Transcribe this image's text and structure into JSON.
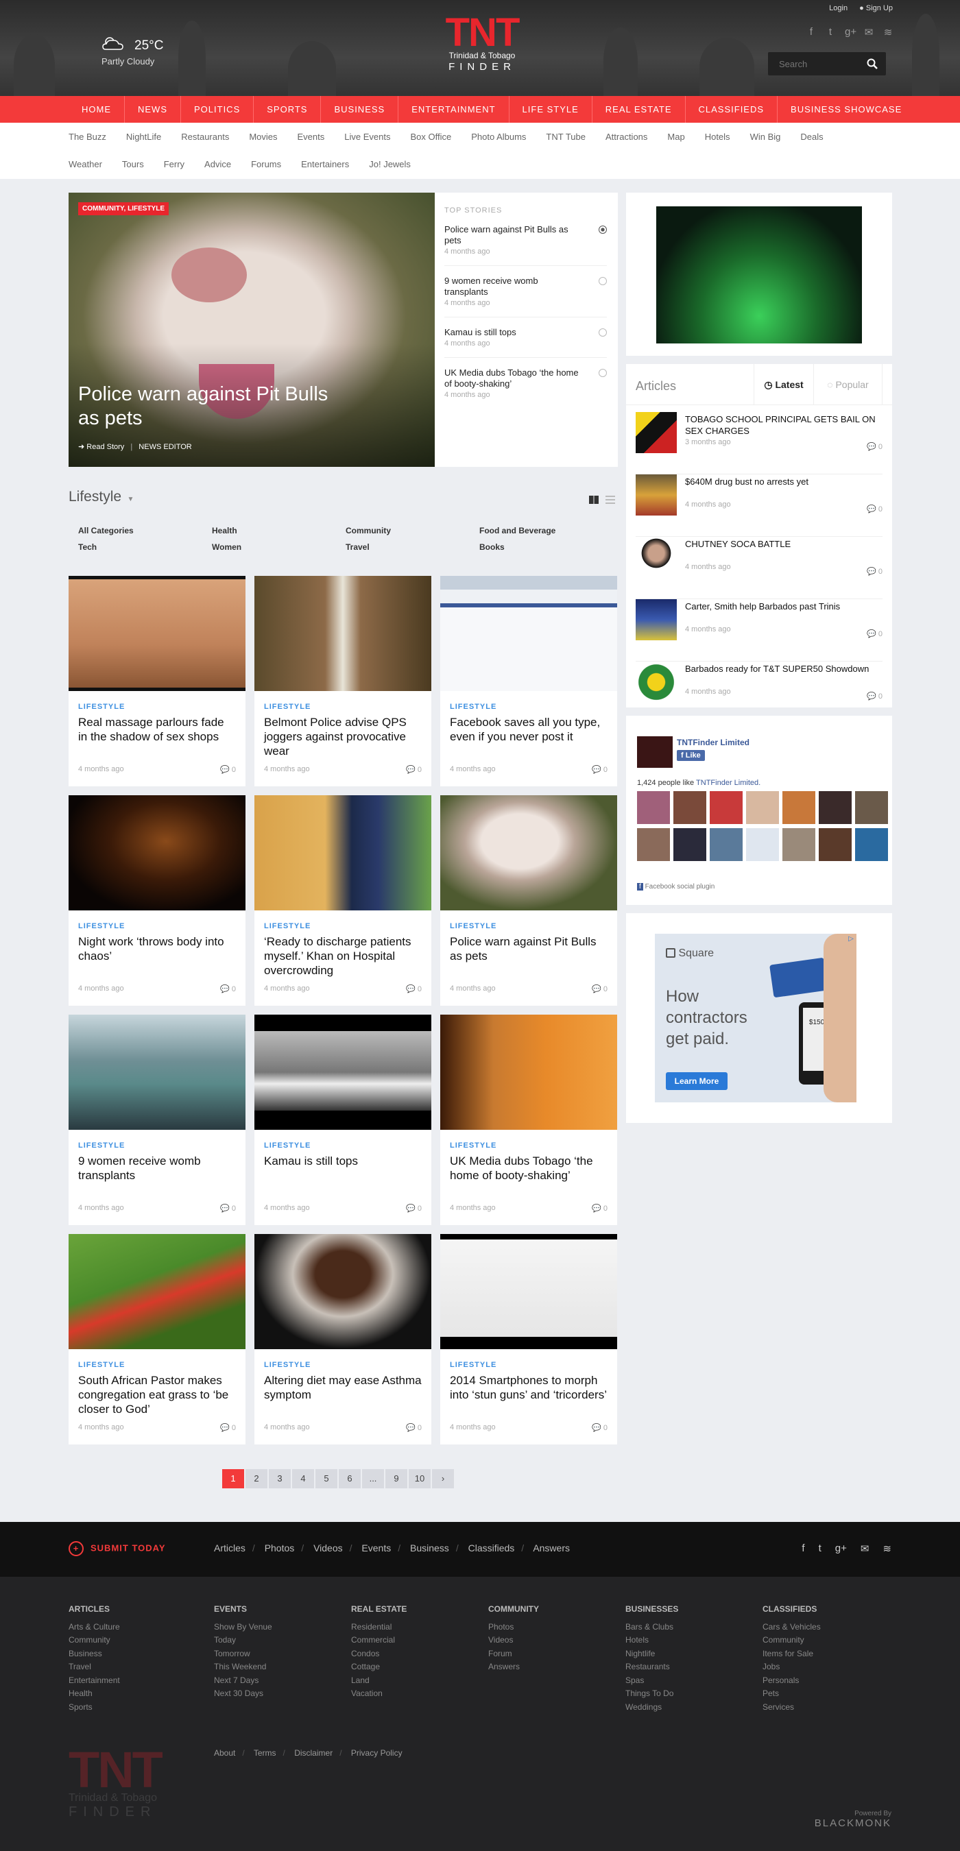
{
  "weather": {
    "temp": "25°C",
    "desc": "Partly Cloudy"
  },
  "logo": {
    "big": "TNT",
    "sub": "Trinidad & Tobago",
    "finder": "FINDER"
  },
  "top_links": {
    "login": "Login",
    "signup": "Sign Up"
  },
  "search": {
    "placeholder": "Search"
  },
  "main_nav": [
    "HOME",
    "NEWS",
    "POLITICS",
    "SPORTS",
    "BUSINESS",
    "ENTERTAINMENT",
    "LIFE STYLE",
    "REAL ESTATE",
    "CLASSIFIEDS",
    "BUSINESS SHOWCASE"
  ],
  "sub_nav_row1": [
    "The Buzz",
    "NightLife",
    "Restaurants",
    "Movies",
    "Events",
    "Live Events",
    "Box Office",
    "Photo Albums",
    "TNT Tube",
    "Attractions",
    "Map",
    "Hotels",
    "Win Big",
    "Deals"
  ],
  "sub_nav_row2": [
    "Weather",
    "Tours",
    "Ferry",
    "Advice",
    "Forums",
    "Entertainers",
    "Jo! Jewels"
  ],
  "hero": {
    "tag": "COMMUNITY, LIFESTYLE",
    "title": "Police warn against Pit Bulls as pets",
    "read": "Read Story",
    "author": "NEWS EDITOR"
  },
  "top_stories": {
    "heading": "TOP STORIES",
    "items": [
      {
        "title": "Police warn against Pit Bulls as pets",
        "time": "4 months ago"
      },
      {
        "title": "9 women receive womb transplants",
        "time": "4 months ago"
      },
      {
        "title": "Kamau is still tops",
        "time": "4 months ago"
      },
      {
        "title": "UK Media dubs Tobago ‘the home of booty-shaking’",
        "time": "4 months ago"
      }
    ]
  },
  "section": {
    "title": "Lifestyle",
    "categories": [
      "All Categories",
      "Health",
      "Community",
      "Food and Beverage",
      "Tech",
      "Women",
      "Travel",
      "Books"
    ]
  },
  "cards": [
    {
      "cat": "LIFESTYLE",
      "title": "Real massage parlours fade in the shadow of sex shops",
      "time": "4 months ago",
      "comments": "0"
    },
    {
      "cat": "LIFESTYLE",
      "title": "Belmont Police advise QPS joggers against provocative wear",
      "time": "4 months ago",
      "comments": "0"
    },
    {
      "cat": "LIFESTYLE",
      "title": "Facebook saves all you type, even if you never post it",
      "time": "4 months ago",
      "comments": "0"
    },
    {
      "cat": "LIFESTYLE",
      "title": "Night work ‘throws body into chaos’",
      "time": "4 months ago",
      "comments": "0"
    },
    {
      "cat": "LIFESTYLE",
      "title": "‘Ready to discharge patients myself.’ Khan on Hospital overcrowding",
      "time": "4 months ago",
      "comments": "0"
    },
    {
      "cat": "LIFESTYLE",
      "title": "Police warn against Pit Bulls as pets",
      "time": "4 months ago",
      "comments": "0"
    },
    {
      "cat": "LIFESTYLE",
      "title": "9 women receive womb transplants",
      "time": "4 months ago",
      "comments": "0"
    },
    {
      "cat": "LIFESTYLE",
      "title": "Kamau is still tops",
      "time": "4 months ago",
      "comments": "0"
    },
    {
      "cat": "LIFESTYLE",
      "title": "UK Media dubs Tobago ‘the home of booty-shaking’",
      "time": "4 months ago",
      "comments": "0"
    },
    {
      "cat": "LIFESTYLE",
      "title": "South African Pastor makes congregation eat grass to ‘be closer to God’",
      "time": "4 months ago",
      "comments": "0"
    },
    {
      "cat": "LIFESTYLE",
      "title": "Altering diet may ease Asthma symptom",
      "time": "4 months ago",
      "comments": "0"
    },
    {
      "cat": "LIFESTYLE",
      "title": "2014 Smartphones to morph into ‘stun guns’ and ‘tricorders’",
      "time": "4 months ago",
      "comments": "0"
    }
  ],
  "pagination": [
    "1",
    "2",
    "3",
    "4",
    "5",
    "6",
    "...",
    "9",
    "10",
    "›"
  ],
  "articles": {
    "heading": "Articles",
    "latest": "Latest",
    "popular": "Popular",
    "items": [
      {
        "title": "TOBAGO SCHOOL PRINCIPAL GETS BAIL ON SEX CHARGES",
        "time": "3 months ago",
        "comments": "0"
      },
      {
        "title": "$640M drug bust no arrests yet",
        "time": "4 months ago",
        "comments": "0"
      },
      {
        "title": "CHUTNEY SOCA BATTLE",
        "time": "4 months ago",
        "comments": "0"
      },
      {
        "title": "Carter, Smith help Barbados past Trinis",
        "time": "4 months ago",
        "comments": "0"
      },
      {
        "title": "Barbados ready for T&T SUPER50 Showdown",
        "time": "4 months ago",
        "comments": "0"
      }
    ]
  },
  "facebook": {
    "name": "TNTFinder Limited",
    "like": "Like",
    "count_prefix": "1,424 people like ",
    "count_link": "TNTFinder Limited.",
    "plugin": "Facebook social plugin"
  },
  "ad": {
    "brand": "Square",
    "text": "How contractors get paid.",
    "cta": "Learn More",
    "price": "$150.00"
  },
  "footer": {
    "submit": "SUBMIT TODAY",
    "links": [
      "Articles",
      "Photos",
      "Videos",
      "Events",
      "Business",
      "Classifieds",
      "Answers"
    ],
    "columns": [
      {
        "h": "ARTICLES",
        "items": [
          "Arts & Culture",
          "Community",
          "Business",
          "Travel",
          "Entertainment",
          "Health",
          "Sports"
        ]
      },
      {
        "h": "EVENTS",
        "items": [
          "Show By Venue",
          "Today",
          "Tomorrow",
          "This Weekend",
          "Next 7 Days",
          "Next 30 Days"
        ]
      },
      {
        "h": "REAL ESTATE",
        "items": [
          "Residential",
          "Commercial",
          "Condos",
          "Cottage",
          "Land",
          "Vacation"
        ]
      },
      {
        "h": "COMMUNITY",
        "items": [
          "Photos",
          "Videos",
          "Forum",
          "Answers"
        ]
      },
      {
        "h": "BUSINESSES",
        "items": [
          "Bars & Clubs",
          "Hotels",
          "Nightlife",
          "Restaurants",
          "Spas",
          "Things To Do",
          "Weddings"
        ]
      },
      {
        "h": "CLASSIFIEDS",
        "items": [
          "Cars & Vehicles",
          "Community",
          "Items for Sale",
          "Jobs",
          "Personals",
          "Pets",
          "Services"
        ]
      }
    ],
    "legal": [
      "About",
      "Terms",
      "Disclaimer",
      "Privacy Policy"
    ],
    "powered_a": "Powered By",
    "powered_b": "BLACKMONK"
  },
  "colors": {
    "accent": "#f33a3a",
    "link": "#3d8fe0"
  }
}
